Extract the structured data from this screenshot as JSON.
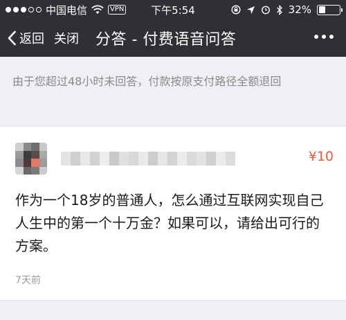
{
  "status_bar": {
    "carrier": "中国电信",
    "vpn_label": "VPN",
    "time": "下午5:54",
    "battery_percent": "32%",
    "battery_level": 0.32,
    "signal_dots": [
      true,
      true,
      true,
      false,
      false
    ],
    "icons": [
      "wifi-icon",
      "lock-rotation-icon",
      "location-icon",
      "alarm-icon",
      "bluetooth-icon"
    ]
  },
  "nav": {
    "back_label": "返回",
    "close_label": "关闭",
    "title": "分答 - 付费语音问答",
    "more_icon": "more-dots-icon"
  },
  "notice": {
    "text": "由于您超过48小时未回答，付款按原支付路径全额退回"
  },
  "question_card": {
    "price": "¥10",
    "question": "作为一个18岁的普通人，怎么通过互联网实现自己人生中的第一个十万金？如果可以，请给出可行的方案。",
    "time_ago": "7天前"
  },
  "colors": {
    "nav_bg": "#2e3034",
    "page_bg": "#efeff4",
    "price": "#f05a3a",
    "notice_text": "#8a8a8a",
    "meta_text": "#9a9a9a"
  }
}
